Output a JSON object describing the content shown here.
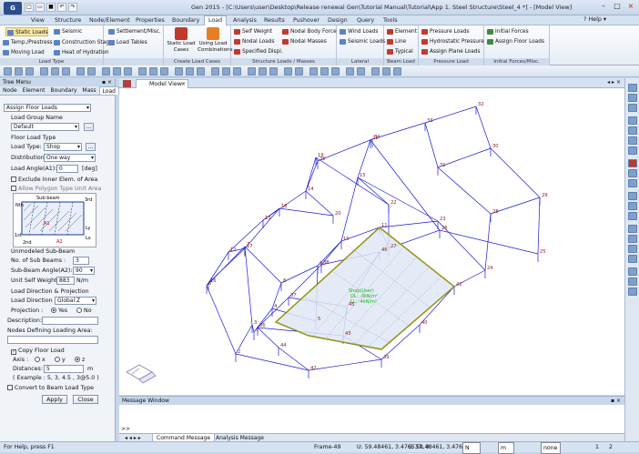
{
  "app": {
    "title": "Gen 2015 - [C:\\Users\\user\\Desktop\\Release renewal Gen\\Tutorial Manual\\Tutorial\\App 1. Steel Structure\\Steel_4 *] - [Model View]",
    "icon_text": "G"
  },
  "menu": {
    "items": [
      "View",
      "Structure",
      "Node/Element",
      "Properties",
      "Boundary",
      "Load",
      "Analysis",
      "Results",
      "Pushover",
      "Design",
      "Query",
      "Tools"
    ],
    "active": "Load",
    "help": "Help"
  },
  "ribbon": {
    "load_type": {
      "items": [
        "Static Loads",
        "Seismic",
        "Settlement/Misc.",
        "Temp./Prestress",
        "Construction Stage",
        "Load Tables",
        "Moving Load",
        "Heat of Hydration"
      ],
      "label": "Load Type"
    },
    "create_load_cases": {
      "btn1": "Static Load Cases",
      "btn2": "Using Load Combinations",
      "label": "Create Load Cases"
    },
    "structure_loads": {
      "items": [
        "Self Weight",
        "Nodal Body Force",
        "Nodal Loads",
        "Nodal Masses",
        "Specified Displ."
      ],
      "label": "Structure Loads / Masses"
    },
    "lateral": {
      "items": [
        "Wind Loads",
        "Seismic Loads"
      ],
      "label": "Lateral"
    },
    "beam_load": {
      "items": [
        "Element",
        "Line",
        "Typical"
      ],
      "label": "Beam Load"
    },
    "pressure_load": {
      "items": [
        "Pressure Loads",
        "Hydrostatic Pressure",
        "Assign Plane Loads"
      ],
      "label": "Pressure Load"
    },
    "initial_forces": {
      "items": [
        "Initial Forces",
        "Assign Floor Loads"
      ],
      "label": "Initial Forces/Misc."
    }
  },
  "tree_menu": {
    "title": "Tree Menu",
    "tabs": [
      "Node",
      "Element",
      "Boundary",
      "Mass",
      "Load"
    ],
    "active_tab": "Load",
    "function": "Assign Floor Loads",
    "load_group_label": "Load Group Name",
    "load_group": "Default",
    "floor_load_type_label": "Floor Load Type",
    "load_type_label": "Load Type:",
    "load_type": "Shop",
    "distribution_label": "Distribution:",
    "distribution": "One way",
    "load_angle_label": "Load Angle(A1):",
    "load_angle": "0",
    "load_angle_unit": "[deg]",
    "exclude_inner": "Exclude Inner Elem. of Area",
    "allow_polygon": "Allow Polygon Type Unit Area",
    "diagram": {
      "sub_beam": "Sub-beam",
      "nth": "Nth",
      "third": "3rd",
      "first": "1st",
      "second": "2nd",
      "a1": "A1",
      "a2": "A2",
      "lx": "Lx",
      "ly": "Ly"
    },
    "unmodeled_label": "Unmodeled Sub-Beam",
    "num_sub_beams_label": "No. of Sub Beams :",
    "num_sub_beams": "3",
    "sub_beam_angle_label": "Sub-Beam Angle(A2):",
    "sub_beam_angle": "90",
    "unit_self_weight_label": "Unit Self Weight:",
    "unit_self_weight": "883",
    "unit_self_weight_unit": "N/m",
    "direction_projection_label": "Load Direction & Projection",
    "load_direction_label": "Load Direction :",
    "load_direction": "Global Z",
    "projection_label": "Projection :",
    "projection_yes": "Yes",
    "projection_no": "No",
    "description_label": "Description:",
    "description": "",
    "nodes_label": "Nodes Defining Loading Area:",
    "copy_floor_load": "Copy Floor Load",
    "axis_label": "Axis :",
    "axis_x": "x",
    "axis_y": "y",
    "axis_z": "z",
    "distances_label": "Distances:",
    "distances": "5",
    "distances_unit": "m",
    "example": "( Example :  5, 3, 4.5 , 3@5.0 )",
    "convert_beam": "Convert to Beam Load Type",
    "apply": "Apply",
    "close": "Close"
  },
  "view": {
    "tab": "Model View",
    "float_label": "Shop(User)",
    "float_l1": "DL: -3kN/m²",
    "float_l2": "LL: -4kN/m²"
  },
  "message_window": {
    "title": "Message Window",
    "prompt": ">>",
    "tabs": [
      "Command Message",
      "Analysis Message"
    ]
  },
  "status": {
    "help": "For Help, press F1",
    "frame": "Frame-49",
    "u": "U: 59.48461, 3.476537, 0",
    "g": "G: 59.48461, 3.476537, 0",
    "unit1": "N",
    "unit2": "m",
    "none": "none",
    "page": "1",
    "page_of": "2"
  },
  "nodes": {
    "labels": [
      "32",
      "33",
      "30",
      "34",
      "31",
      "35",
      "29",
      "28",
      "26",
      "27",
      "25",
      "24",
      "23",
      "22",
      "21",
      "20",
      "19",
      "18",
      "17",
      "16",
      "15",
      "14",
      "13",
      "12",
      "11",
      "10",
      "9",
      "8",
      "7",
      "6",
      "5",
      "4",
      "3",
      "2",
      "1",
      "42",
      "43",
      "41",
      "40",
      "39",
      "38",
      "37",
      "36",
      "46",
      "45",
      "44"
    ]
  }
}
